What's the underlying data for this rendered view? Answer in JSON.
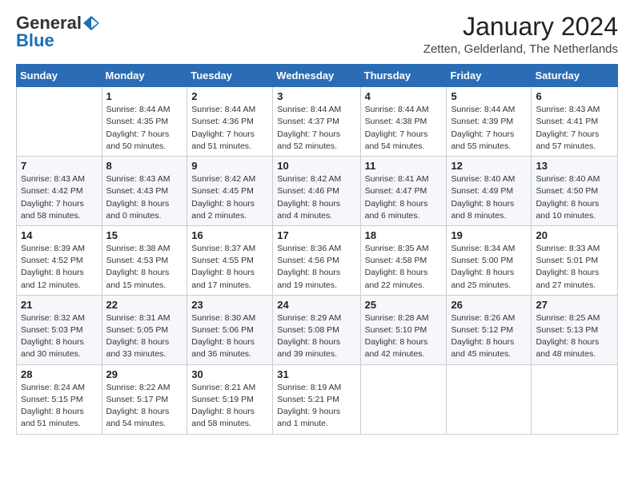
{
  "header": {
    "logo_general": "General",
    "logo_blue": "Blue",
    "month_year": "January 2024",
    "location": "Zetten, Gelderland, The Netherlands"
  },
  "days_of_week": [
    "Sunday",
    "Monday",
    "Tuesday",
    "Wednesday",
    "Thursday",
    "Friday",
    "Saturday"
  ],
  "weeks": [
    [
      {
        "day": "",
        "info": ""
      },
      {
        "day": "1",
        "info": "Sunrise: 8:44 AM\nSunset: 4:35 PM\nDaylight: 7 hours\nand 50 minutes."
      },
      {
        "day": "2",
        "info": "Sunrise: 8:44 AM\nSunset: 4:36 PM\nDaylight: 7 hours\nand 51 minutes."
      },
      {
        "day": "3",
        "info": "Sunrise: 8:44 AM\nSunset: 4:37 PM\nDaylight: 7 hours\nand 52 minutes."
      },
      {
        "day": "4",
        "info": "Sunrise: 8:44 AM\nSunset: 4:38 PM\nDaylight: 7 hours\nand 54 minutes."
      },
      {
        "day": "5",
        "info": "Sunrise: 8:44 AM\nSunset: 4:39 PM\nDaylight: 7 hours\nand 55 minutes."
      },
      {
        "day": "6",
        "info": "Sunrise: 8:43 AM\nSunset: 4:41 PM\nDaylight: 7 hours\nand 57 minutes."
      }
    ],
    [
      {
        "day": "7",
        "info": "Sunrise: 8:43 AM\nSunset: 4:42 PM\nDaylight: 7 hours\nand 58 minutes."
      },
      {
        "day": "8",
        "info": "Sunrise: 8:43 AM\nSunset: 4:43 PM\nDaylight: 8 hours\nand 0 minutes."
      },
      {
        "day": "9",
        "info": "Sunrise: 8:42 AM\nSunset: 4:45 PM\nDaylight: 8 hours\nand 2 minutes."
      },
      {
        "day": "10",
        "info": "Sunrise: 8:42 AM\nSunset: 4:46 PM\nDaylight: 8 hours\nand 4 minutes."
      },
      {
        "day": "11",
        "info": "Sunrise: 8:41 AM\nSunset: 4:47 PM\nDaylight: 8 hours\nand 6 minutes."
      },
      {
        "day": "12",
        "info": "Sunrise: 8:40 AM\nSunset: 4:49 PM\nDaylight: 8 hours\nand 8 minutes."
      },
      {
        "day": "13",
        "info": "Sunrise: 8:40 AM\nSunset: 4:50 PM\nDaylight: 8 hours\nand 10 minutes."
      }
    ],
    [
      {
        "day": "14",
        "info": "Sunrise: 8:39 AM\nSunset: 4:52 PM\nDaylight: 8 hours\nand 12 minutes."
      },
      {
        "day": "15",
        "info": "Sunrise: 8:38 AM\nSunset: 4:53 PM\nDaylight: 8 hours\nand 15 minutes."
      },
      {
        "day": "16",
        "info": "Sunrise: 8:37 AM\nSunset: 4:55 PM\nDaylight: 8 hours\nand 17 minutes."
      },
      {
        "day": "17",
        "info": "Sunrise: 8:36 AM\nSunset: 4:56 PM\nDaylight: 8 hours\nand 19 minutes."
      },
      {
        "day": "18",
        "info": "Sunrise: 8:35 AM\nSunset: 4:58 PM\nDaylight: 8 hours\nand 22 minutes."
      },
      {
        "day": "19",
        "info": "Sunrise: 8:34 AM\nSunset: 5:00 PM\nDaylight: 8 hours\nand 25 minutes."
      },
      {
        "day": "20",
        "info": "Sunrise: 8:33 AM\nSunset: 5:01 PM\nDaylight: 8 hours\nand 27 minutes."
      }
    ],
    [
      {
        "day": "21",
        "info": "Sunrise: 8:32 AM\nSunset: 5:03 PM\nDaylight: 8 hours\nand 30 minutes."
      },
      {
        "day": "22",
        "info": "Sunrise: 8:31 AM\nSunset: 5:05 PM\nDaylight: 8 hours\nand 33 minutes."
      },
      {
        "day": "23",
        "info": "Sunrise: 8:30 AM\nSunset: 5:06 PM\nDaylight: 8 hours\nand 36 minutes."
      },
      {
        "day": "24",
        "info": "Sunrise: 8:29 AM\nSunset: 5:08 PM\nDaylight: 8 hours\nand 39 minutes."
      },
      {
        "day": "25",
        "info": "Sunrise: 8:28 AM\nSunset: 5:10 PM\nDaylight: 8 hours\nand 42 minutes."
      },
      {
        "day": "26",
        "info": "Sunrise: 8:26 AM\nSunset: 5:12 PM\nDaylight: 8 hours\nand 45 minutes."
      },
      {
        "day": "27",
        "info": "Sunrise: 8:25 AM\nSunset: 5:13 PM\nDaylight: 8 hours\nand 48 minutes."
      }
    ],
    [
      {
        "day": "28",
        "info": "Sunrise: 8:24 AM\nSunset: 5:15 PM\nDaylight: 8 hours\nand 51 minutes."
      },
      {
        "day": "29",
        "info": "Sunrise: 8:22 AM\nSunset: 5:17 PM\nDaylight: 8 hours\nand 54 minutes."
      },
      {
        "day": "30",
        "info": "Sunrise: 8:21 AM\nSunset: 5:19 PM\nDaylight: 8 hours\nand 58 minutes."
      },
      {
        "day": "31",
        "info": "Sunrise: 8:19 AM\nSunset: 5:21 PM\nDaylight: 9 hours\nand 1 minute."
      },
      {
        "day": "",
        "info": ""
      },
      {
        "day": "",
        "info": ""
      },
      {
        "day": "",
        "info": ""
      }
    ]
  ]
}
